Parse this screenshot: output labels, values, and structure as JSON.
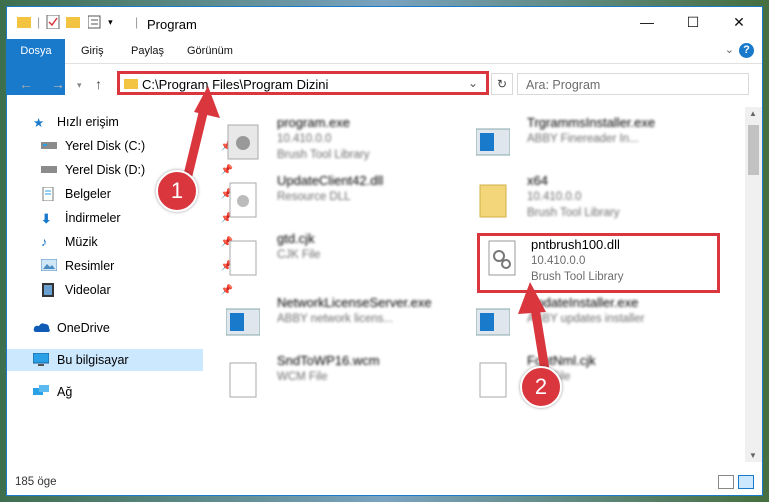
{
  "window": {
    "title": "Program",
    "colors": {
      "accent": "#1979ca",
      "highlight": "#d9363e",
      "selected": "#cce8ff"
    }
  },
  "ribbon": {
    "tabs": [
      "Dosya",
      "Giriş",
      "Paylaş",
      "Görünüm"
    ],
    "help_icon": "?"
  },
  "address": {
    "path": "C:\\Program Files\\Program Dizini",
    "search_placeholder": "Ara: Program"
  },
  "sidebar": {
    "items": [
      {
        "label": "Hızlı erişim",
        "icon": "star-icon"
      },
      {
        "label": "Yerel Disk (C:)",
        "icon": "drive-icon"
      },
      {
        "label": "Yerel Disk (D:)",
        "icon": "drive-icon"
      },
      {
        "label": "Belgeler",
        "icon": "documents-icon"
      },
      {
        "label": "İndirmeler",
        "icon": "download-icon"
      },
      {
        "label": "Müzik",
        "icon": "music-icon"
      },
      {
        "label": "Resimler",
        "icon": "pictures-icon"
      },
      {
        "label": "Videolar",
        "icon": "video-icon"
      },
      {
        "label": "OneDrive",
        "icon": "cloud-icon"
      },
      {
        "label": "Bu bilgisayar",
        "icon": "computer-icon"
      },
      {
        "label": "Ağ",
        "icon": "network-icon"
      }
    ]
  },
  "files": [
    {
      "name": "program.exe",
      "line2": "10.410.0.0",
      "line3": "Brush Tool Library"
    },
    {
      "name": "TrgrammsInstaller.exe",
      "line2": "ABBY Finereader In...",
      "line3": ""
    },
    {
      "name": "UpdateClient42.dll",
      "line2": "Resource DLL",
      "line3": ""
    },
    {
      "name": "x64",
      "line2": "10.410.0.0",
      "line3": "Brush Tool Library"
    },
    {
      "name": "gtd.cjk",
      "line2": "CJK File",
      "line3": ""
    },
    {
      "name": "pntbrush100.dll",
      "line2": "10.410.0.0",
      "line3": "Brush Tool Library"
    },
    {
      "name": "NetworkLicenseServer.exe",
      "line2": "ABBY network licens...",
      "line3": ""
    },
    {
      "name": "UpdateInstaller.exe",
      "line2": "ABBY updates installer",
      "line3": ""
    },
    {
      "name": "SndToWP16.wcm",
      "line2": "WCM File",
      "line3": ""
    },
    {
      "name": "FontNml.cjk",
      "line2": "CJK File",
      "line3": ""
    }
  ],
  "status": {
    "item_count": "185 öge"
  },
  "callouts": [
    "1",
    "2"
  ]
}
